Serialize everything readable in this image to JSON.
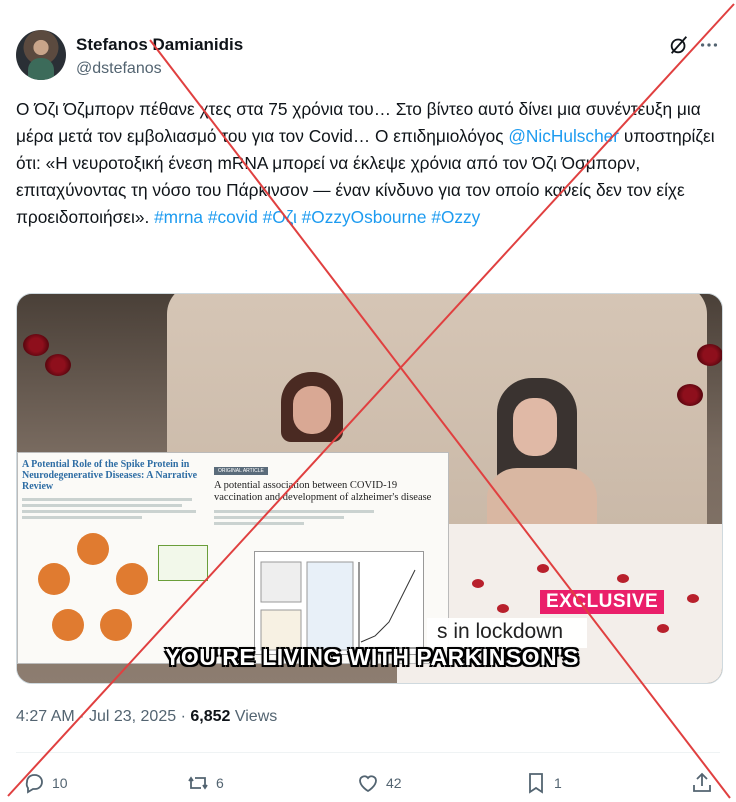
{
  "author": {
    "name": "Stefanos Damianidis",
    "handle": "@dstefanos"
  },
  "icons": {
    "avatar": "profile-photo",
    "grok": "slashed-circle-icon",
    "more": "more-dots-icon",
    "reply": "reply-icon",
    "repost": "repost-icon",
    "like": "heart-icon",
    "bookmark": "bookmark-icon",
    "share": "share-icon"
  },
  "tweet": {
    "text_before_mention": "Ο Όζι Όζμπορν πέθανε χτες στα 75 χρόνια του… Στο βίντεο αυτό δίνει μια συνέντευξη μια μέρα μετά τον εμβολιασμό του για τον Covid… Ο επιδημιολόγος ",
    "mention": "@NicHulscher",
    "text_after_mention": " υποστηρίζει ότι: «Η νευροτοξική ένεση mRNA μπορεί να έκλεψε χρόνια από τον Όζι Όσμπορν, επιταχύνοντας τη νόσο του Πάρκινσον — έναν κίνδυνο για τον οποίο κανείς δεν τον είχε προειδοποιήσει». ",
    "hashtags": [
      "#mrna",
      "#covid",
      "#Οζι",
      "#OzzyOsbourne",
      "#Ozzy"
    ]
  },
  "media": {
    "paper_left_title": "A Potential Role of the Spike Protein in Neurodegenerative Diseases: A Narrative Review",
    "paper_right_badge": "ORIGINAL ARTICLE",
    "paper_right_title": "A potential association between COVID-19 vaccination and development of alzheimer's disease",
    "exclusive_badge": "EXCLUSIVE",
    "lower_third": "s in lockdown",
    "caption": "YOU'RE LIVING WITH PARKINSON'S",
    "overlay": "red-x-cross"
  },
  "meta": {
    "time": "4:27 AM",
    "separator": "·",
    "date": "Jul 23, 2025",
    "views_count": "6,852",
    "views_label": "Views"
  },
  "actions": {
    "replies": "10",
    "reposts": "6",
    "likes": "42",
    "bookmarks": "1"
  },
  "colors": {
    "link": "#1d9bf0",
    "text": "#0f1419",
    "muted": "#536471",
    "exclusive": "#ea1f6a",
    "cross": "#e04040"
  }
}
